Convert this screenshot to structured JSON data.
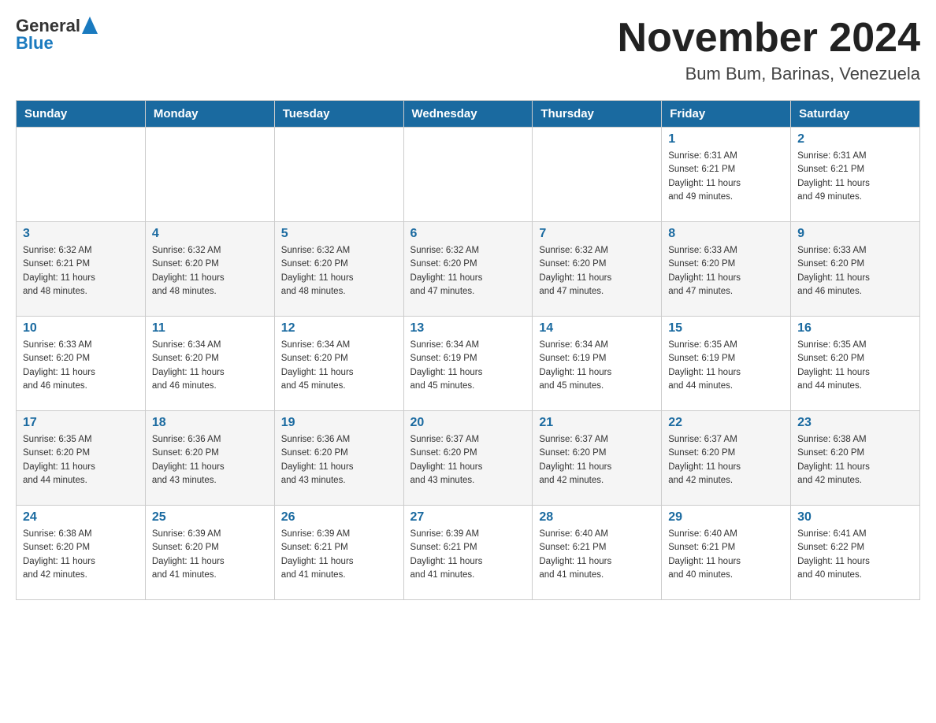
{
  "header": {
    "title": "November 2024",
    "location": "Bum Bum, Barinas, Venezuela",
    "logo_general": "General",
    "logo_blue": "Blue"
  },
  "days_of_week": [
    "Sunday",
    "Monday",
    "Tuesday",
    "Wednesday",
    "Thursday",
    "Friday",
    "Saturday"
  ],
  "weeks": [
    [
      {
        "day": "",
        "info": ""
      },
      {
        "day": "",
        "info": ""
      },
      {
        "day": "",
        "info": ""
      },
      {
        "day": "",
        "info": ""
      },
      {
        "day": "",
        "info": ""
      },
      {
        "day": "1",
        "info": "Sunrise: 6:31 AM\nSunset: 6:21 PM\nDaylight: 11 hours\nand 49 minutes."
      },
      {
        "day": "2",
        "info": "Sunrise: 6:31 AM\nSunset: 6:21 PM\nDaylight: 11 hours\nand 49 minutes."
      }
    ],
    [
      {
        "day": "3",
        "info": "Sunrise: 6:32 AM\nSunset: 6:21 PM\nDaylight: 11 hours\nand 48 minutes."
      },
      {
        "day": "4",
        "info": "Sunrise: 6:32 AM\nSunset: 6:20 PM\nDaylight: 11 hours\nand 48 minutes."
      },
      {
        "day": "5",
        "info": "Sunrise: 6:32 AM\nSunset: 6:20 PM\nDaylight: 11 hours\nand 48 minutes."
      },
      {
        "day": "6",
        "info": "Sunrise: 6:32 AM\nSunset: 6:20 PM\nDaylight: 11 hours\nand 47 minutes."
      },
      {
        "day": "7",
        "info": "Sunrise: 6:32 AM\nSunset: 6:20 PM\nDaylight: 11 hours\nand 47 minutes."
      },
      {
        "day": "8",
        "info": "Sunrise: 6:33 AM\nSunset: 6:20 PM\nDaylight: 11 hours\nand 47 minutes."
      },
      {
        "day": "9",
        "info": "Sunrise: 6:33 AM\nSunset: 6:20 PM\nDaylight: 11 hours\nand 46 minutes."
      }
    ],
    [
      {
        "day": "10",
        "info": "Sunrise: 6:33 AM\nSunset: 6:20 PM\nDaylight: 11 hours\nand 46 minutes."
      },
      {
        "day": "11",
        "info": "Sunrise: 6:34 AM\nSunset: 6:20 PM\nDaylight: 11 hours\nand 46 minutes."
      },
      {
        "day": "12",
        "info": "Sunrise: 6:34 AM\nSunset: 6:20 PM\nDaylight: 11 hours\nand 45 minutes."
      },
      {
        "day": "13",
        "info": "Sunrise: 6:34 AM\nSunset: 6:19 PM\nDaylight: 11 hours\nand 45 minutes."
      },
      {
        "day": "14",
        "info": "Sunrise: 6:34 AM\nSunset: 6:19 PM\nDaylight: 11 hours\nand 45 minutes."
      },
      {
        "day": "15",
        "info": "Sunrise: 6:35 AM\nSunset: 6:19 PM\nDaylight: 11 hours\nand 44 minutes."
      },
      {
        "day": "16",
        "info": "Sunrise: 6:35 AM\nSunset: 6:20 PM\nDaylight: 11 hours\nand 44 minutes."
      }
    ],
    [
      {
        "day": "17",
        "info": "Sunrise: 6:35 AM\nSunset: 6:20 PM\nDaylight: 11 hours\nand 44 minutes."
      },
      {
        "day": "18",
        "info": "Sunrise: 6:36 AM\nSunset: 6:20 PM\nDaylight: 11 hours\nand 43 minutes."
      },
      {
        "day": "19",
        "info": "Sunrise: 6:36 AM\nSunset: 6:20 PM\nDaylight: 11 hours\nand 43 minutes."
      },
      {
        "day": "20",
        "info": "Sunrise: 6:37 AM\nSunset: 6:20 PM\nDaylight: 11 hours\nand 43 minutes."
      },
      {
        "day": "21",
        "info": "Sunrise: 6:37 AM\nSunset: 6:20 PM\nDaylight: 11 hours\nand 42 minutes."
      },
      {
        "day": "22",
        "info": "Sunrise: 6:37 AM\nSunset: 6:20 PM\nDaylight: 11 hours\nand 42 minutes."
      },
      {
        "day": "23",
        "info": "Sunrise: 6:38 AM\nSunset: 6:20 PM\nDaylight: 11 hours\nand 42 minutes."
      }
    ],
    [
      {
        "day": "24",
        "info": "Sunrise: 6:38 AM\nSunset: 6:20 PM\nDaylight: 11 hours\nand 42 minutes."
      },
      {
        "day": "25",
        "info": "Sunrise: 6:39 AM\nSunset: 6:20 PM\nDaylight: 11 hours\nand 41 minutes."
      },
      {
        "day": "26",
        "info": "Sunrise: 6:39 AM\nSunset: 6:21 PM\nDaylight: 11 hours\nand 41 minutes."
      },
      {
        "day": "27",
        "info": "Sunrise: 6:39 AM\nSunset: 6:21 PM\nDaylight: 11 hours\nand 41 minutes."
      },
      {
        "day": "28",
        "info": "Sunrise: 6:40 AM\nSunset: 6:21 PM\nDaylight: 11 hours\nand 41 minutes."
      },
      {
        "day": "29",
        "info": "Sunrise: 6:40 AM\nSunset: 6:21 PM\nDaylight: 11 hours\nand 40 minutes."
      },
      {
        "day": "30",
        "info": "Sunrise: 6:41 AM\nSunset: 6:22 PM\nDaylight: 11 hours\nand 40 minutes."
      }
    ]
  ]
}
